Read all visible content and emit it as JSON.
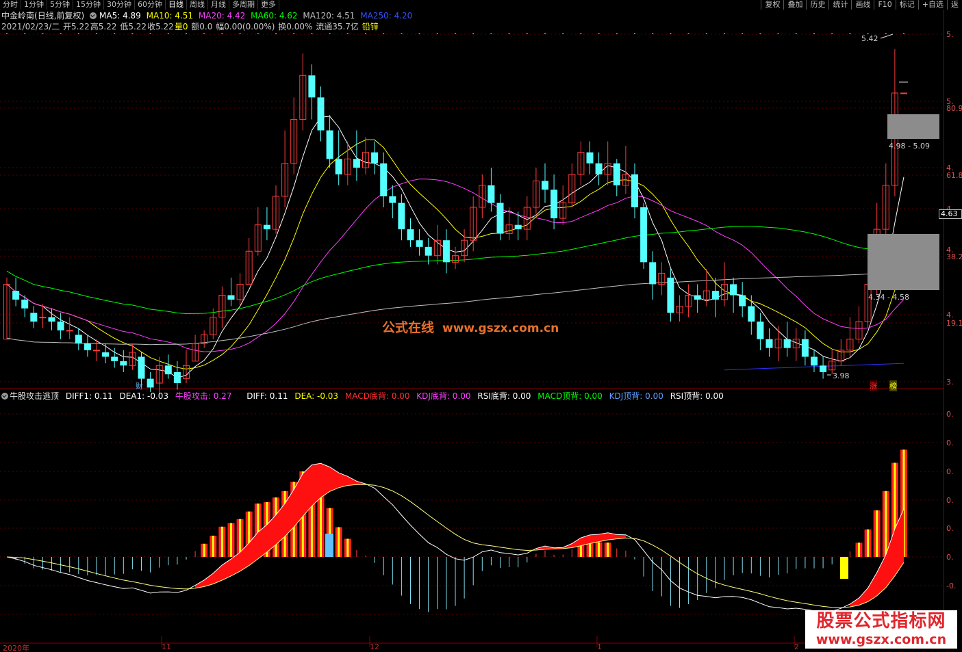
{
  "toolbar": {
    "tabs": [
      "分时",
      "1分钟",
      "5分钟",
      "15分钟",
      "30分钟",
      "60分钟",
      "日线",
      "周线",
      "月线",
      "多周期",
      "更多"
    ],
    "active_tab": "日线",
    "tools": [
      "复权",
      "叠加",
      "历史",
      "统计",
      "画线",
      "F10",
      "标记",
      "+自选",
      "返"
    ]
  },
  "stock": {
    "name": "中金岭南",
    "mode": "(日线,前复权)",
    "ma5": "MA5: 4.89",
    "ma10": "MA10: 4.51",
    "ma20": "MA20: 4.42",
    "ma60": "MA60: 4.62",
    "ma120": "MA120: 4.51",
    "ma250": "MA250: 4.20"
  },
  "bar_info": {
    "date": "2021/02/23/二",
    "open": "开5.22",
    "high": "高5.22",
    "low": "低5.22",
    "close": "收5.22",
    "vol": "量0",
    "amt": "额0.0",
    "amp": "幅0.00(0.00%)",
    "turn": "换0.00%",
    "float": "流通35.7亿",
    "sector": "铅锌"
  },
  "indicator": {
    "name": "牛股攻击逃顶",
    "diff1": "DIFF1: 0.11",
    "dea1": "DEA1: -0.03",
    "attack": "牛股攻击: 0.27",
    "diff": "DIFF: 0.11",
    "dea": "DEA: -0.03",
    "macd_bottom": "MACD底背: 0.00",
    "kdj_bottom": "KDJ底背: 0.00",
    "rsi_bottom": "RSI底背: 0.00",
    "macd_top": "MACD顶背: 0.00",
    "kdj_top": "KDJ顶背: 0.00",
    "rsi_top": "RSI顶背: 0.00"
  },
  "annotations": {
    "high_price": "5.42",
    "low_price": "3.98",
    "zone_upper": "4.98 - 5.09",
    "zone_lower": "4.34 - 4.58",
    "current_price": "4.63",
    "cai_marker": "财",
    "zhang_marker": "涨",
    "bang_marker": "榜"
  },
  "axes": {
    "right_main": [
      "5.",
      "5.",
      "80.9",
      "4.",
      "61.8",
      "4.",
      "4.",
      "38.2",
      "4.",
      "19.1",
      "3."
    ],
    "right_ind": [
      "0.",
      "0.",
      "0.",
      "0.",
      "0.",
      "0.",
      "-0.",
      "-0."
    ],
    "dates": [
      "2020年",
      "11",
      "12",
      "1",
      "2"
    ]
  },
  "watermarks": {
    "center_cn": "公式在线",
    "center_url": "www.gszx.com.cn",
    "corner_l1": "股票公式指标网",
    "corner_l2": "www.gszx.com.cn"
  },
  "colors": {
    "up": "#ff3c3c",
    "down": "#54ffff",
    "ma5": "#ffffff",
    "ma10": "#ffff00",
    "ma20": "#ff40ff",
    "ma60": "#00ff00",
    "ma120": "#c0c0c0",
    "ma250": "#3030ff"
  },
  "chart_data": {
    "type": "candlestick",
    "price_range": [
      3.9,
      5.5
    ],
    "candles": [
      [
        4.1,
        4.35,
        4.1,
        4.38
      ],
      [
        4.32,
        4.28,
        4.25,
        4.38
      ],
      [
        4.28,
        4.24,
        4.2,
        4.3
      ],
      [
        4.22,
        4.18,
        4.15,
        4.25
      ],
      [
        4.2,
        4.2,
        4.15,
        4.26
      ],
      [
        4.2,
        4.18,
        4.14,
        4.24
      ],
      [
        4.18,
        4.14,
        4.1,
        4.22
      ],
      [
        4.14,
        4.14,
        4.1,
        4.2
      ],
      [
        4.12,
        4.08,
        4.05,
        4.15
      ],
      [
        4.08,
        4.05,
        4.02,
        4.12
      ],
      [
        4.05,
        4.05,
        4.0,
        4.1
      ],
      [
        4.04,
        4.02,
        3.99,
        4.08
      ],
      [
        4.02,
        4.0,
        3.97,
        4.06
      ],
      [
        4.0,
        3.98,
        3.95,
        4.05
      ],
      [
        3.98,
        4.04,
        3.96,
        4.08
      ],
      [
        4.02,
        3.92,
        3.88,
        4.04
      ],
      [
        3.92,
        3.88,
        3.86,
        3.95
      ],
      [
        3.9,
        3.98,
        3.85,
        4.02
      ],
      [
        3.98,
        3.94,
        3.92,
        4.03
      ],
      [
        3.95,
        3.9,
        3.87,
        4.0
      ],
      [
        3.92,
        3.98,
        3.9,
        4.05
      ],
      [
        4.0,
        4.08,
        4.0,
        4.12
      ],
      [
        4.08,
        4.12,
        4.06,
        4.14
      ],
      [
        4.12,
        4.2,
        4.1,
        4.24
      ],
      [
        4.2,
        4.3,
        4.15,
        4.34
      ],
      [
        4.3,
        4.28,
        4.25,
        4.38
      ],
      [
        4.28,
        4.35,
        4.25,
        4.4
      ],
      [
        4.35,
        4.5,
        4.35,
        4.56
      ],
      [
        4.5,
        4.62,
        4.48,
        4.7
      ],
      [
        4.62,
        4.6,
        4.55,
        4.7
      ],
      [
        4.6,
        4.75,
        4.58,
        4.8
      ],
      [
        4.75,
        4.9,
        4.7,
        5.05
      ],
      [
        4.9,
        5.1,
        4.85,
        5.2
      ],
      [
        5.1,
        5.3,
        5.05,
        5.4
      ],
      [
        5.3,
        5.2,
        5.1,
        5.35
      ],
      [
        5.2,
        5.05,
        5.0,
        5.25
      ],
      [
        5.05,
        4.92,
        4.88,
        5.12
      ],
      [
        4.92,
        4.85,
        4.8,
        5.05
      ],
      [
        4.85,
        4.92,
        4.8,
        5.0
      ],
      [
        4.92,
        4.88,
        4.82,
        5.05
      ],
      [
        4.88,
        4.95,
        4.85,
        5.02
      ],
      [
        4.95,
        4.9,
        4.85,
        5.0
      ],
      [
        4.9,
        4.75,
        4.7,
        4.95
      ],
      [
        4.75,
        4.72,
        4.65,
        4.8
      ],
      [
        4.72,
        4.6,
        4.55,
        4.76
      ],
      [
        4.6,
        4.55,
        4.52,
        4.65
      ],
      [
        4.55,
        4.52,
        4.48,
        4.6
      ],
      [
        4.52,
        4.48,
        4.44,
        4.56
      ],
      [
        4.48,
        4.55,
        4.44,
        4.62
      ],
      [
        4.55,
        4.45,
        4.4,
        4.6
      ],
      [
        4.45,
        4.48,
        4.42,
        4.52
      ],
      [
        4.48,
        4.55,
        4.45,
        4.6
      ],
      [
        4.55,
        4.7,
        4.5,
        4.75
      ],
      [
        4.7,
        4.8,
        4.65,
        4.85
      ],
      [
        4.8,
        4.72,
        4.68,
        4.88
      ],
      [
        4.72,
        4.58,
        4.55,
        4.76
      ],
      [
        4.58,
        4.62,
        4.55,
        4.7
      ],
      [
        4.62,
        4.6,
        4.55,
        4.68
      ],
      [
        4.6,
        4.7,
        4.55,
        4.75
      ],
      [
        4.7,
        4.82,
        4.65,
        4.88
      ],
      [
        4.82,
        4.78,
        4.72,
        4.9
      ],
      [
        4.78,
        4.65,
        4.6,
        4.85
      ],
      [
        4.65,
        4.72,
        4.62,
        4.8
      ],
      [
        4.72,
        4.85,
        4.7,
        4.9
      ],
      [
        4.85,
        4.95,
        4.8,
        5.0
      ],
      [
        4.95,
        4.9,
        4.85,
        5.0
      ],
      [
        4.9,
        4.85,
        4.8,
        4.95
      ],
      [
        4.85,
        4.9,
        4.8,
        5.0
      ],
      [
        4.9,
        4.8,
        4.75,
        4.92
      ],
      [
        4.8,
        4.85,
        4.76,
        4.98
      ],
      [
        4.85,
        4.7,
        4.65,
        4.9
      ],
      [
        4.7,
        4.45,
        4.42,
        4.72
      ],
      [
        4.45,
        4.35,
        4.28,
        4.5
      ],
      [
        4.35,
        4.4,
        4.3,
        4.45
      ],
      [
        4.38,
        4.22,
        4.18,
        4.42
      ],
      [
        4.22,
        4.25,
        4.18,
        4.3
      ],
      [
        4.25,
        4.3,
        4.2,
        4.35
      ],
      [
        4.3,
        4.28,
        4.22,
        4.35
      ],
      [
        4.28,
        4.32,
        4.25,
        4.42
      ],
      [
        4.32,
        4.28,
        4.2,
        4.38
      ],
      [
        4.28,
        4.35,
        4.25,
        4.45
      ],
      [
        4.35,
        4.3,
        4.22,
        4.38
      ],
      [
        4.3,
        4.25,
        4.2,
        4.36
      ],
      [
        4.25,
        4.18,
        4.12,
        4.3
      ],
      [
        4.18,
        4.1,
        4.05,
        4.22
      ],
      [
        4.1,
        4.06,
        4.02,
        4.15
      ],
      [
        4.06,
        4.1,
        4.0,
        4.16
      ],
      [
        4.1,
        4.06,
        4.02,
        4.18
      ],
      [
        4.06,
        4.1,
        4.0,
        4.15
      ],
      [
        4.1,
        4.02,
        3.98,
        4.14
      ],
      [
        4.02,
        3.98,
        3.95,
        4.05
      ],
      [
        3.98,
        3.95,
        3.92,
        4.02
      ],
      [
        3.96,
        4.0,
        3.94,
        4.05
      ],
      [
        4.0,
        4.05,
        3.98,
        4.1
      ],
      [
        4.05,
        4.1,
        4.02,
        4.2
      ],
      [
        4.1,
        4.18,
        4.08,
        4.25
      ],
      [
        4.18,
        4.35,
        4.15,
        4.5
      ],
      [
        4.35,
        4.6,
        4.3,
        4.72
      ],
      [
        4.6,
        4.8,
        4.55,
        4.9
      ],
      [
        4.8,
        5.22,
        4.75,
        5.42
      ],
      [
        5.22,
        5.22,
        5.22,
        5.22
      ]
    ]
  }
}
